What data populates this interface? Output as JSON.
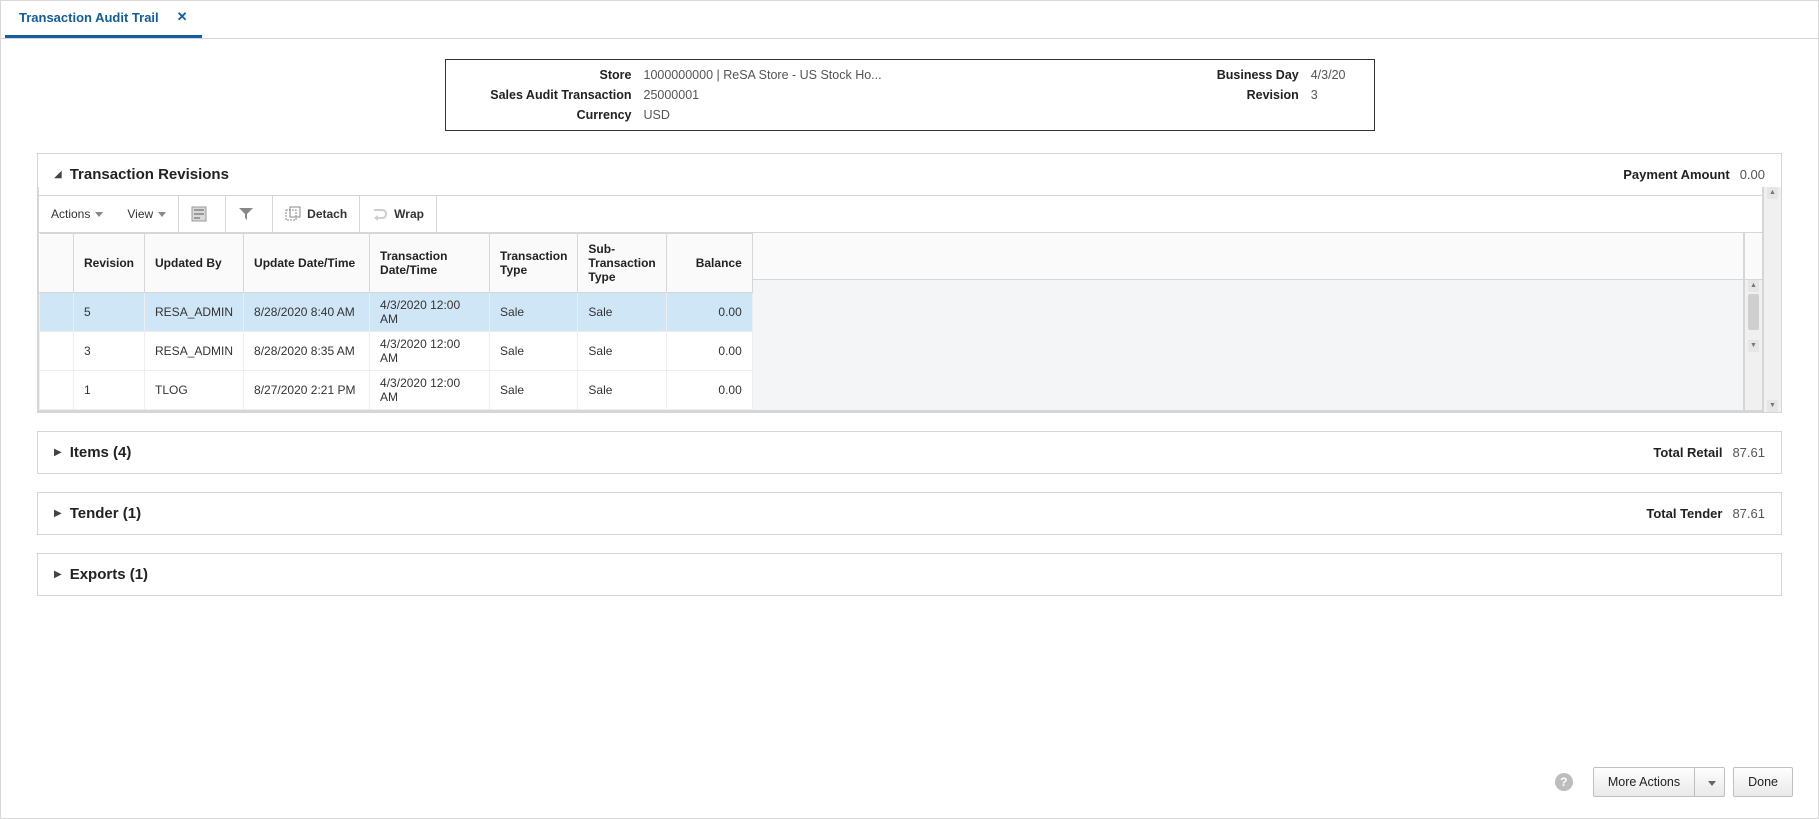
{
  "tab": {
    "label": "Transaction Audit Trail"
  },
  "summary": {
    "store_label": "Store",
    "store_value": "1000000000 | ReSA Store - US Stock Ho...",
    "sat_label": "Sales Audit Transaction",
    "sat_value": "25000001",
    "currency_label": "Currency",
    "currency_value": "USD",
    "bday_label": "Business Day",
    "bday_value": "4/3/20",
    "rev_label": "Revision",
    "rev_value": "3"
  },
  "revisions_panel": {
    "title": "Transaction Revisions",
    "right_label": "Payment Amount",
    "right_value": "0.00",
    "toolbar": {
      "actions": "Actions",
      "view": "View",
      "detach": "Detach",
      "wrap": "Wrap"
    },
    "headers": {
      "revision": "Revision",
      "updated_by": "Updated By",
      "update_dt": "Update Date/Time",
      "tran_dt": "Transaction Date/Time",
      "tran_type": "Transaction Type",
      "sub_type": "Sub-Transaction Type",
      "balance": "Balance"
    },
    "rows": [
      {
        "revision": "5",
        "updated_by": "RESA_ADMIN",
        "update_dt": "8/28/2020 8:40 AM",
        "tran_dt": "4/3/2020 12:00 AM",
        "tran_type": "Sale",
        "sub_type": "Sale",
        "balance": "0.00"
      },
      {
        "revision": "3",
        "updated_by": "RESA_ADMIN",
        "update_dt": "8/28/2020 8:35 AM",
        "tran_dt": "4/3/2020 12:00 AM",
        "tran_type": "Sale",
        "sub_type": "Sale",
        "balance": "0.00"
      },
      {
        "revision": "1",
        "updated_by": "TLOG",
        "update_dt": "8/27/2020 2:21 PM",
        "tran_dt": "4/3/2020 12:00 AM",
        "tran_type": "Sale",
        "sub_type": "Sale",
        "balance": "0.00"
      }
    ]
  },
  "items_panel": {
    "title": "Items (4)",
    "right_label": "Total Retail",
    "right_value": "87.61"
  },
  "tender_panel": {
    "title": "Tender (1)",
    "right_label": "Total Tender",
    "right_value": "87.61"
  },
  "exports_panel": {
    "title": "Exports (1)"
  },
  "footer": {
    "more_actions": "More Actions",
    "done": "Done"
  }
}
